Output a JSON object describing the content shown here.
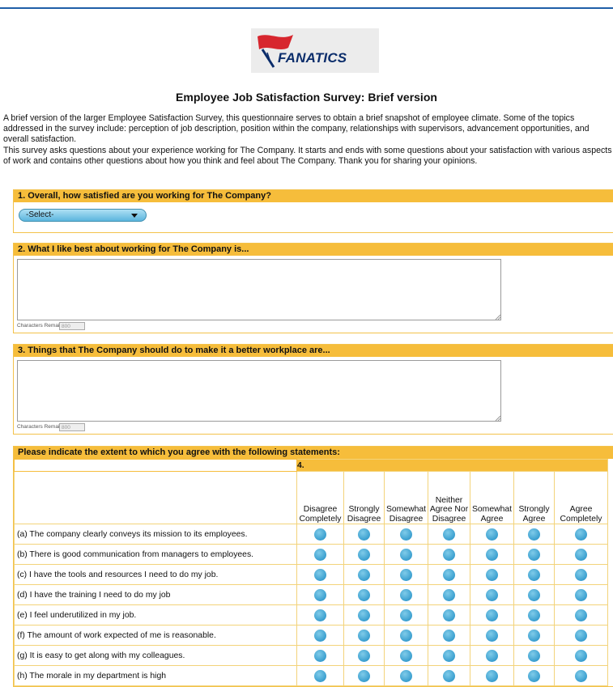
{
  "brand": {
    "logo_text": "FANATICS"
  },
  "page": {
    "title": "Employee Job Satisfaction Survey: Brief version",
    "intro_p1": "A brief version of the larger Employee Satisfaction Survey, this questionnaire serves to obtain a brief snapshot of employee climate. Some of the topics addressed in the survey include: perception of job description, position within the company, relationships with supervisors, advancement opportunities, and overall satisfaction.",
    "intro_p2": "This survey asks questions about your experience working for The Company. It starts and ends with some questions about your satisfaction with various aspects of work and contains other questions about how you think and feel about The Company. Thank you for sharing your opinions."
  },
  "q1": {
    "label": "1. Overall, how satisfied are you working for The Company?",
    "select_value": "-Select-"
  },
  "q2": {
    "label": "2. What I like best about working for The Company is...",
    "chars_label": "Characters Remaining:",
    "chars_value": "800"
  },
  "q3": {
    "label": "3. Things that The Company should do to make it a better workplace are...",
    "chars_label": "Characters Remaining:",
    "chars_value": "800"
  },
  "q4": {
    "header": "Please indicate the extent to which you agree with the following statements:",
    "number": "4.",
    "columns": [
      "Disagree Completely",
      "Strongly Disagree",
      "Somewhat Disagree",
      "Neither Agree Nor Disagree",
      "Somewhat Agree",
      "Strongly Agree",
      "Agree Completely"
    ],
    "statements": [
      "(a) The company clearly conveys its mission to its employees.",
      "(b) There is good communication from managers to employees.",
      "(c) I have the tools and resources I need to do my job.",
      "(d) I have the training I need to do my job",
      "(e) I feel underutilized in my job.",
      "(f) The amount of work expected of me is reasonable.",
      "(g) It is easy to get along with my colleagues.",
      "(h) The morale in my department is high"
    ]
  },
  "colors": {
    "accent_bar": "#f6bd3b",
    "top_line": "#1f5fa8",
    "radio": "#3a9fcf"
  }
}
